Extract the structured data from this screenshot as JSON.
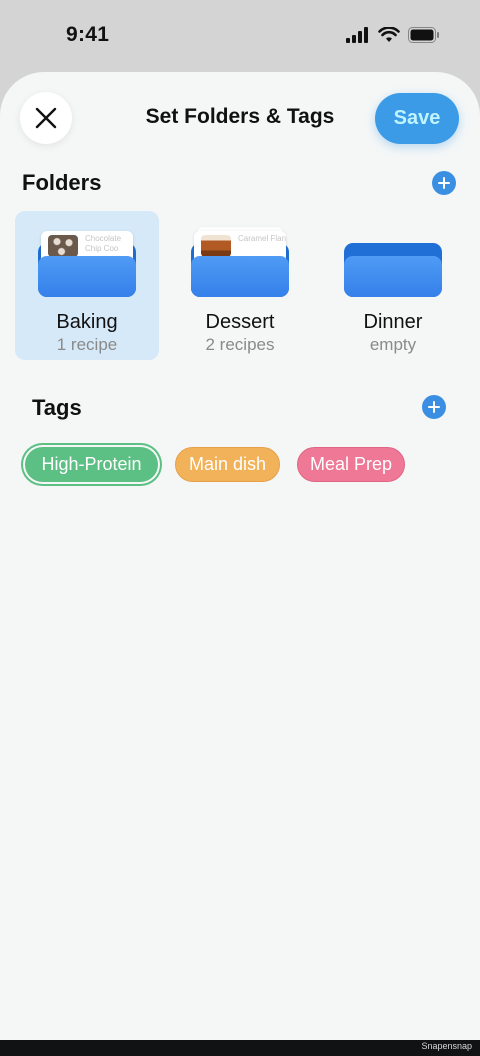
{
  "status_bar": {
    "time": "9:41",
    "icons": [
      "cellular-signal-icon",
      "wifi-icon",
      "battery-icon"
    ]
  },
  "sheet": {
    "title": "Set Folders & Tags",
    "save_label": "Save",
    "close_icon": "close-icon"
  },
  "folders": {
    "title": "Folders",
    "add_icon": "plus-icon",
    "items": [
      {
        "name": "Baking",
        "count": "1 recipe",
        "selected": true,
        "card_label": "Chocolate Chip Coo"
      },
      {
        "name": "Dessert",
        "count": "2 recipes",
        "selected": false,
        "card_label": "Caramel Flan"
      },
      {
        "name": "Dinner",
        "count": "empty",
        "selected": false,
        "card_label": ""
      }
    ]
  },
  "tags": {
    "title": "Tags",
    "add_icon": "plus-icon",
    "items": [
      {
        "label": "High-Protein",
        "color": "#5cbf83",
        "selected": true
      },
      {
        "label": "Main dish",
        "color": "#f2b25a",
        "selected": false
      },
      {
        "label": "Meal Prep",
        "color": "#ee7896",
        "selected": false
      }
    ]
  },
  "colors": {
    "accent": "#3b9be6",
    "folder_blue": "#3580ea",
    "selected_bg": "#d5e9f8"
  },
  "watermark": "Snapensnap"
}
